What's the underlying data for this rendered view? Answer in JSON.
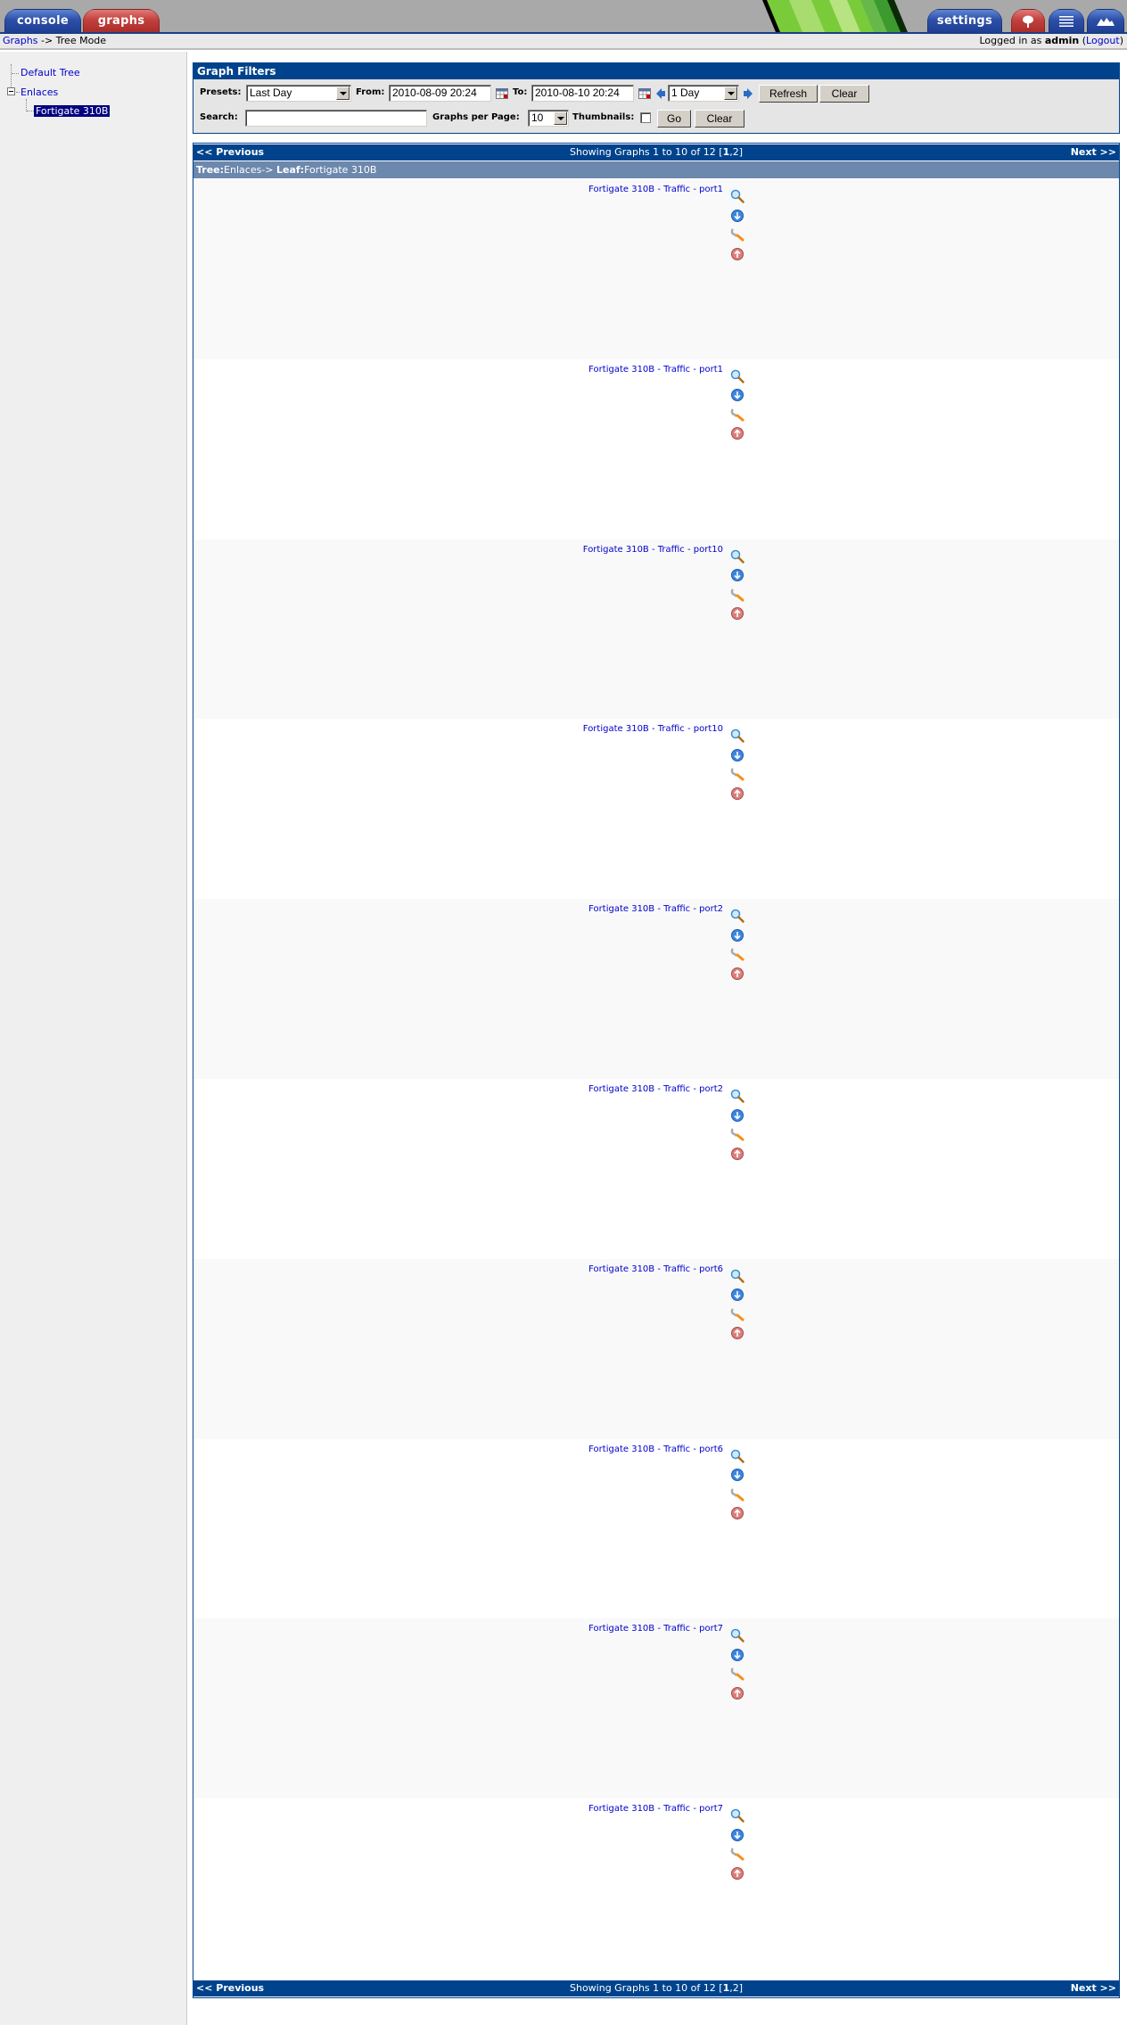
{
  "tabs": {
    "console": "console",
    "graphs": "graphs",
    "settings": "settings",
    "tree_icon": "tree-view-icon",
    "list_icon": "list-view-icon",
    "preview_icon": "preview-view-icon"
  },
  "breadcrumb": {
    "link": "Graphs",
    "separator": " -> ",
    "current": "Tree Mode"
  },
  "login": {
    "prefix": "Logged in as ",
    "user": "admin",
    "open_paren": " (",
    "logout": "Logout",
    "close_paren": ")"
  },
  "sidebar": {
    "items": [
      {
        "label": "Default Tree",
        "level": 0
      },
      {
        "label": "Enlaces",
        "level": 0,
        "expanded": true
      },
      {
        "label": "Fortigate 310B",
        "level": 1,
        "selected": true
      }
    ]
  },
  "filters": {
    "title": "Graph Filters",
    "presets_label": "Presets:",
    "presets_value": "Last Day",
    "from_label": "From:",
    "from_value": "2010-08-09 20:24",
    "to_label": "To:",
    "to_value": "2010-08-10 20:24",
    "timespan_value": "1 Day",
    "refresh_label": "Refresh",
    "clear_label": "Clear",
    "search_label": "Search:",
    "search_value": "",
    "graphs_per_page_label": "Graphs per Page:",
    "graphs_per_page_value": "10",
    "thumbnails_label": "Thumbnails:",
    "thumbnails_checked": false,
    "go_label": "Go",
    "clear2_label": "Clear"
  },
  "pagination": {
    "prev": "<< Previous",
    "next": "Next >>",
    "showing_prefix": "Showing Graphs 1 to 10 of 12 [",
    "current_page": "1",
    "rest_pages": ",2]"
  },
  "treebar": {
    "tree_label": "Tree:",
    "tree_value": "Enlaces-> ",
    "leaf_label": "Leaf:",
    "leaf_value": "Fortigate 310B"
  },
  "graphs": [
    {
      "title": "Fortigate 310B - Traffic - port1"
    },
    {
      "title": "Fortigate 310B - Traffic - port1"
    },
    {
      "title": "Fortigate 310B - Traffic - port10"
    },
    {
      "title": "Fortigate 310B - Traffic - port10"
    },
    {
      "title": "Fortigate 310B - Traffic - port2"
    },
    {
      "title": "Fortigate 310B - Traffic - port2"
    },
    {
      "title": "Fortigate 310B - Traffic - port6"
    },
    {
      "title": "Fortigate 310B - Traffic - port6"
    },
    {
      "title": "Fortigate 310B - Traffic - port7"
    },
    {
      "title": "Fortigate 310B - Traffic - port7"
    }
  ],
  "graph_actions": [
    "zoom-graph",
    "export-csv",
    "graph-debug",
    "view-realtime"
  ]
}
